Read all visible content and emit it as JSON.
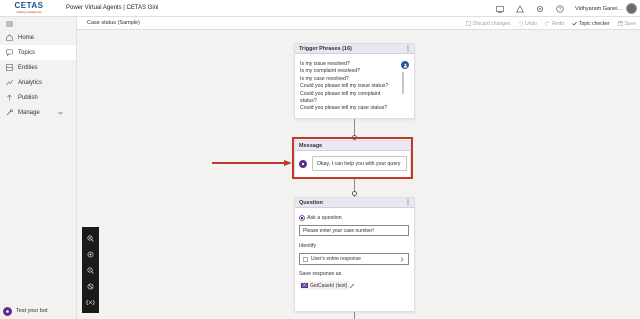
{
  "header": {
    "logo_text": "CETAS",
    "logo_subtitle": "making intelligence",
    "app_title": "Power Virtual Agents | CETAS Gini",
    "user_name": "Vidhyaram Ganei..."
  },
  "sidebar": {
    "items": [
      {
        "label": "Home",
        "icon": "home-icon"
      },
      {
        "label": "Topics",
        "icon": "topics-icon",
        "active": true
      },
      {
        "label": "Entities",
        "icon": "entities-icon"
      },
      {
        "label": "Analytics",
        "icon": "analytics-icon"
      },
      {
        "label": "Publish",
        "icon": "publish-icon"
      },
      {
        "label": "Manage",
        "icon": "manage-icon",
        "expandable": true
      }
    ],
    "test_bot_label": "Test your bot"
  },
  "subheader": {
    "topic_name": "Case status (Sample)",
    "actions": {
      "discard": "Discard changes",
      "undo": "Undo",
      "redo": "Redo",
      "topic_checker": "Topic checker",
      "save": "Save"
    }
  },
  "canvas": {
    "trigger": {
      "title": "Trigger Phrases (16)",
      "phrases": [
        "Is my issue resolved?",
        "Is my complaint resolved?",
        "Is my case resolved?",
        "Could you please tell my issue status?",
        "Could you please tell my complaint",
        "status?",
        "Could you please tell my case status?"
      ]
    },
    "message": {
      "title": "Message",
      "text": "Okay, I can help you with your query"
    },
    "question": {
      "title": "Question",
      "ask_label": "Ask a question",
      "question_text": "Please enter your case number!",
      "identify_label": "Identify",
      "identify_value": "User's entire response",
      "save_label": "Save response as",
      "variable": "GetCaseId",
      "variable_type": "(text)"
    }
  },
  "colors": {
    "accent": "#5c2d91",
    "highlight": "#c0392b",
    "node_header": "#e8e6f3"
  }
}
